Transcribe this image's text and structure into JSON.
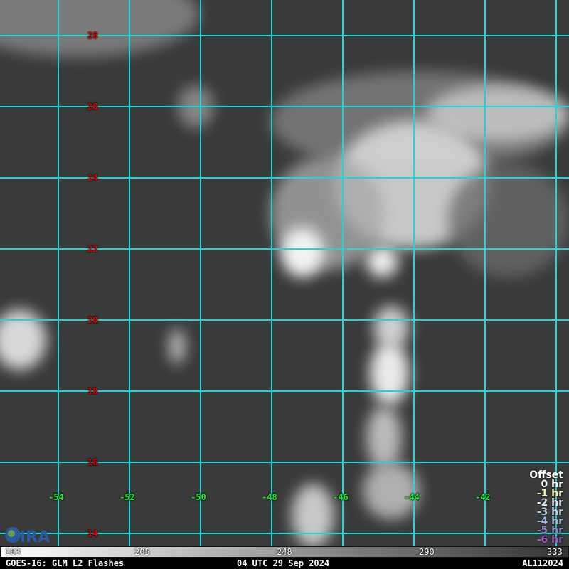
{
  "map": {
    "latitudes": [
      "28",
      "26",
      "24",
      "22",
      "20",
      "18",
      "16",
      "14"
    ],
    "longitudes": [
      "-54",
      "-52",
      "-50",
      "-48",
      "-46",
      "-44",
      "-42"
    ]
  },
  "legend": {
    "title": "Offset",
    "items": [
      {
        "label": "0 hr",
        "color": "#ffffff"
      },
      {
        "label": "-1 hr",
        "color": "#f4f0b0"
      },
      {
        "label": "-2 hr",
        "color": "#dde6f0"
      },
      {
        "label": "-3 hr",
        "color": "#bcd0e8"
      },
      {
        "label": "-4 hr",
        "color": "#a0b4dc"
      },
      {
        "label": "-5 hr",
        "color": "#8888c8"
      },
      {
        "label": "-6 hr",
        "color": "#9a5cc0"
      }
    ]
  },
  "colorbar": {
    "ticks": [
      "163",
      "205",
      "248",
      "290",
      "333"
    ]
  },
  "status": {
    "product": "GOES-16: GLM L2 Flashes",
    "time": "04 UTC 29 Sep 2024",
    "storm_id": "AL112024"
  },
  "logo": {
    "text": "CIRA"
  }
}
